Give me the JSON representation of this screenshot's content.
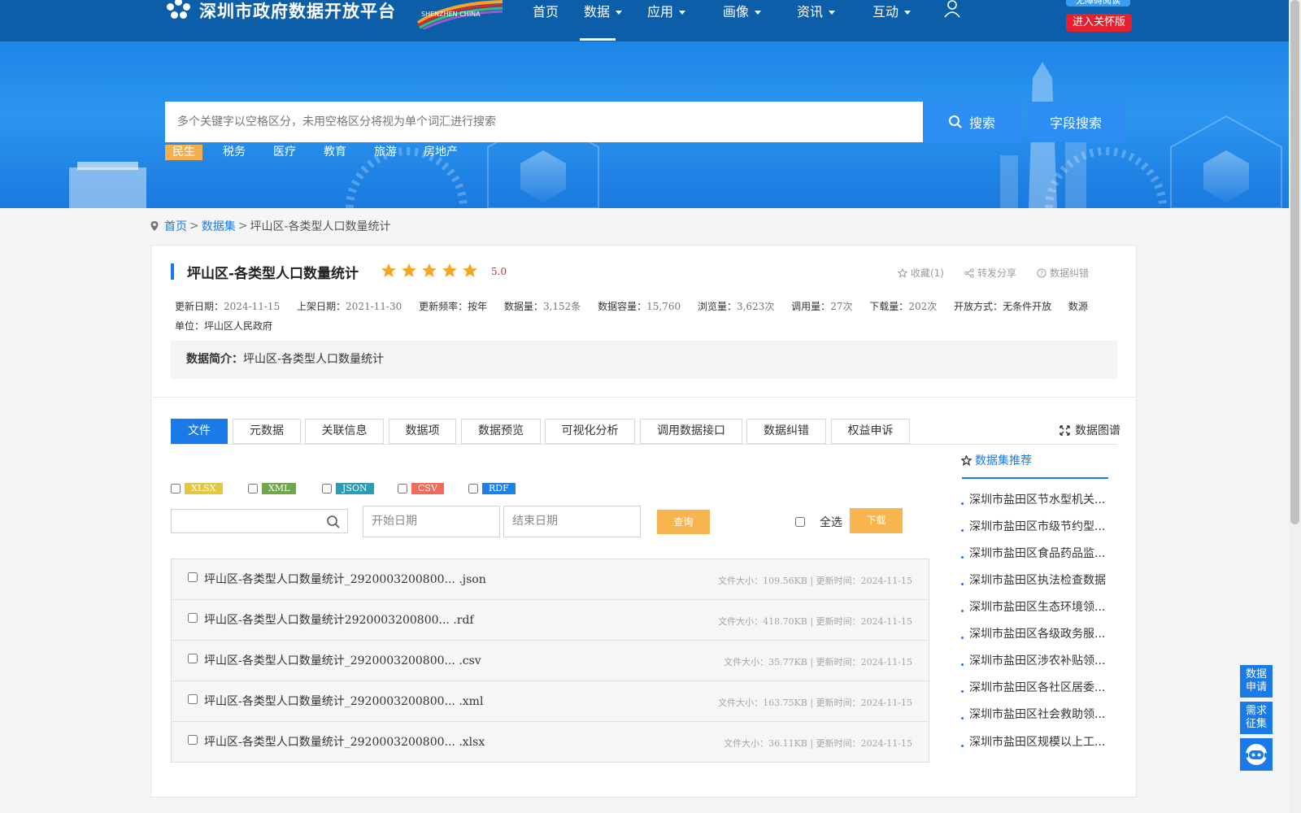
{
  "header": {
    "site_title": "深圳市政府数据开放平台",
    "brand_text": "SHENZHEN CHINA",
    "nav": [
      {
        "label": "首页",
        "has_caret": false
      },
      {
        "label": "数据",
        "has_caret": true
      },
      {
        "label": "应用",
        "has_caret": true
      },
      {
        "label": "画像",
        "has_caret": true
      },
      {
        "label": "资讯",
        "has_caret": true
      },
      {
        "label": "互动",
        "has_caret": true
      }
    ],
    "active_nav": "数据",
    "top_pill_label": "无障碍阅读",
    "care_mode_label": "进入关怀版",
    "user_icon": "user-icon"
  },
  "search": {
    "placeholder": "多个关键字以空格区分，未用空格区分将视为单个词汇进行搜索",
    "search_label": "搜索",
    "field_search_label": "字段搜索",
    "hot_words": [
      "民生",
      "税务",
      "医疗",
      "教育",
      "旅游",
      "房地产"
    ],
    "active_hot_word": "民生"
  },
  "breadcrumb": {
    "home": "首页",
    "sep": ">",
    "datasets": "数据集",
    "current": "坪山区-各类型人口数量统计"
  },
  "dataset": {
    "title": "坪山区-各类型人口数量统计",
    "rating": 5,
    "score": "5.0",
    "actions": {
      "favorite": "收藏(1)",
      "share": "转发分享",
      "correct": "数据纠错"
    },
    "meta": [
      {
        "label": "更新日期：",
        "value": "2024-11-15"
      },
      {
        "label": "上架日期：",
        "value": "2021-11-30"
      },
      {
        "label": "更新频率：",
        "value": "按年"
      },
      {
        "label": "数据量：",
        "value": "3,152条"
      },
      {
        "label": "数据容量：",
        "value": "15,760"
      },
      {
        "label": "浏览量：",
        "value": "3,623次"
      },
      {
        "label": "调用量：",
        "value": "27次"
      },
      {
        "label": "下载量：",
        "value": "202次"
      },
      {
        "label": "开放方式：",
        "value": "无条件开放"
      },
      {
        "label": "数源单位：",
        "value": "坪山区人民政府"
      }
    ],
    "intro_label": "数据简介：",
    "intro_text": "坪山区-各类型人口数量统计"
  },
  "tabs": {
    "items": [
      "文件",
      "元数据",
      "关联信息",
      "数据项",
      "数据预览",
      "可视化分析",
      "调用数据接口",
      "数据纠错",
      "权益申诉"
    ],
    "active": "文件",
    "graph_label": "数据图谱"
  },
  "formats": [
    {
      "label": "XLSX",
      "color": "#e3c73f"
    },
    {
      "label": "XML",
      "color": "#6ea84a"
    },
    {
      "label": "JSON",
      "color": "#2a9db6"
    },
    {
      "label": "CSV",
      "color": "#f26a5a"
    },
    {
      "label": "RDF",
      "color": "#1a82e8"
    }
  ],
  "filters": {
    "keyword_value": "",
    "start_placeholder": "开始日期",
    "end_placeholder": "结束日期",
    "query_label": "查询",
    "select_all_label": "全选",
    "download_label": "下载"
  },
  "files": [
    {
      "name": "坪山区-各类型人口数量统计_2920003200800... .json",
      "size_label": "文件大小：",
      "size": "109.56KB",
      "time_label": "更新时间：",
      "time": "2024-11-15"
    },
    {
      "name": "坪山区-各类型人口数量统计2920003200800... .rdf",
      "size_label": "文件大小：",
      "size": "418.70KB",
      "time_label": "更新时间：",
      "time": "2024-11-15"
    },
    {
      "name": "坪山区-各类型人口数量统计_2920003200800... .csv",
      "size_label": "文件大小：",
      "size": "35.77KB",
      "time_label": "更新时间：",
      "time": "2024-11-15"
    },
    {
      "name": "坪山区-各类型人口数量统计_2920003200800... .xml",
      "size_label": "文件大小：",
      "size": "163.75KB",
      "time_label": "更新时间：",
      "time": "2024-11-15"
    },
    {
      "name": "坪山区-各类型人口数量统计_2920003200800... .xlsx",
      "size_label": "文件大小：",
      "size": "36.11KB",
      "time_label": "更新时间：",
      "time": "2024-11-15"
    }
  ],
  "recommend": {
    "title": "数据集推荐",
    "items": [
      "深圳市盐田区节水型机关...",
      "深圳市盐田区市级节约型...",
      "深圳市盐田区食品药品监...",
      "深圳市盐田区执法检查数据",
      "深圳市盐田区生态环境领...",
      "深圳市盐田区各级政务服...",
      "深圳市盐田区涉农补贴领...",
      "深圳市盐田区各社区居委...",
      "深圳市盐田区社会救助领...",
      "深圳市盐田区规模以上工..."
    ]
  },
  "floating": {
    "data_apply": [
      "数据",
      "申请"
    ],
    "demand": [
      "需求",
      "征集"
    ],
    "assistant_icon": "robot-icon"
  },
  "colors": {
    "header_bg": "#0d5ea8",
    "accent": "#1a7ae8",
    "orange": "#f8b54f",
    "red": "#e8202e",
    "star": "#f5a623"
  }
}
